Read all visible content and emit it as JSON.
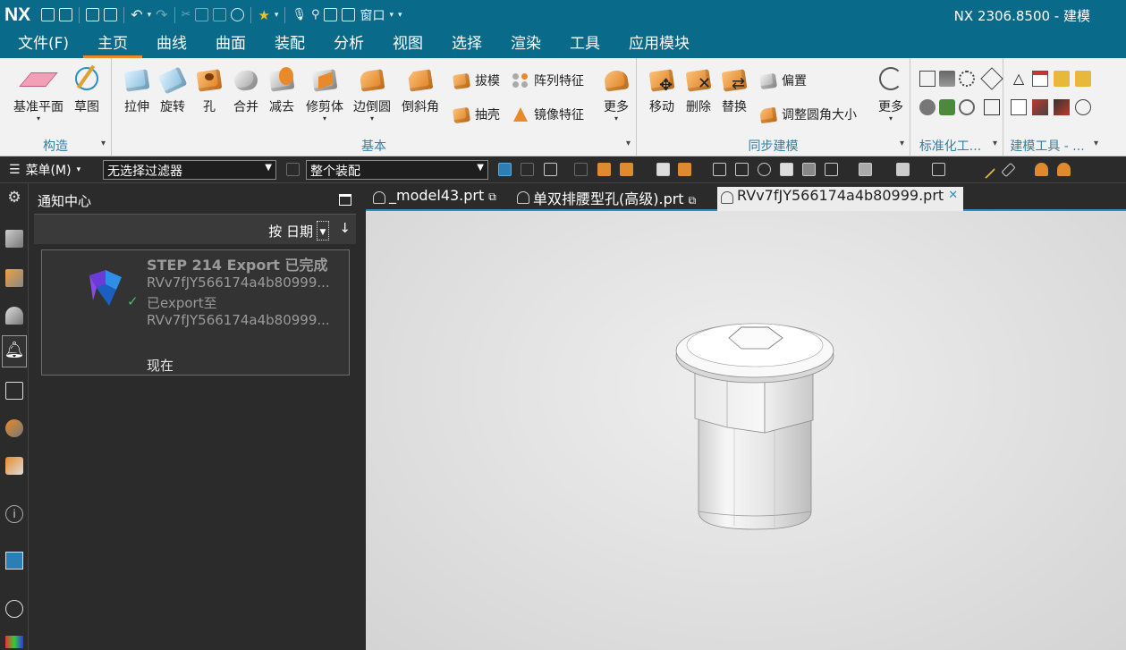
{
  "app": {
    "logo": "NX",
    "title": "NX 2306.8500 - 建模",
    "window_menu": "窗口"
  },
  "menu": {
    "items": [
      "文件(F)",
      "主页",
      "曲线",
      "曲面",
      "装配",
      "分析",
      "视图",
      "选择",
      "渲染",
      "工具",
      "应用模块"
    ],
    "active": "主页"
  },
  "ribbon": {
    "groups": [
      {
        "label": "构造",
        "buttons": [
          "基准平面",
          "草图"
        ]
      },
      {
        "label": "基本",
        "buttons": [
          "拉伸",
          "旋转",
          "孔",
          "合并",
          "减去",
          "修剪体",
          "边倒圆",
          "倒斜角"
        ],
        "small": [
          "拔模",
          "阵列特征",
          "抽壳",
          "镜像特征"
        ],
        "more": "更多"
      },
      {
        "label": "同步建模",
        "buttons": [
          "移动",
          "删除",
          "替换"
        ],
        "small": [
          "偏置",
          "调整圆角大小"
        ],
        "more": "更多"
      },
      {
        "label": "标准化工..."
      },
      {
        "label": "建模工具 - ..."
      }
    ]
  },
  "toolbar2": {
    "menu_label": "菜单(M)",
    "filter_value": "无选择过滤器",
    "scope_value": "整个装配"
  },
  "left_panel": {
    "title": "通知中心",
    "sort_label": "按 日期",
    "sort_arrow": "↓",
    "notification": {
      "title": "STEP 214 Export 已完成",
      "line1": "RVv7fJY566174a4b80999...",
      "line2": "已export至",
      "line3": "RVv7fJY566174a4b80999...",
      "time": "现在"
    }
  },
  "tabs": [
    {
      "label": "_model43.prt",
      "active": false
    },
    {
      "label": "单双排腰型孔(高级).prt",
      "active": false
    },
    {
      "label": "RVv7fJY566174a4b80999.prt",
      "active": true
    }
  ],
  "colors": {
    "titlebar": "#0a6a89",
    "accent_underline": "#e98a2a",
    "tab_active_border": "#2c8fc0",
    "viewport": "#e0e0e0"
  }
}
